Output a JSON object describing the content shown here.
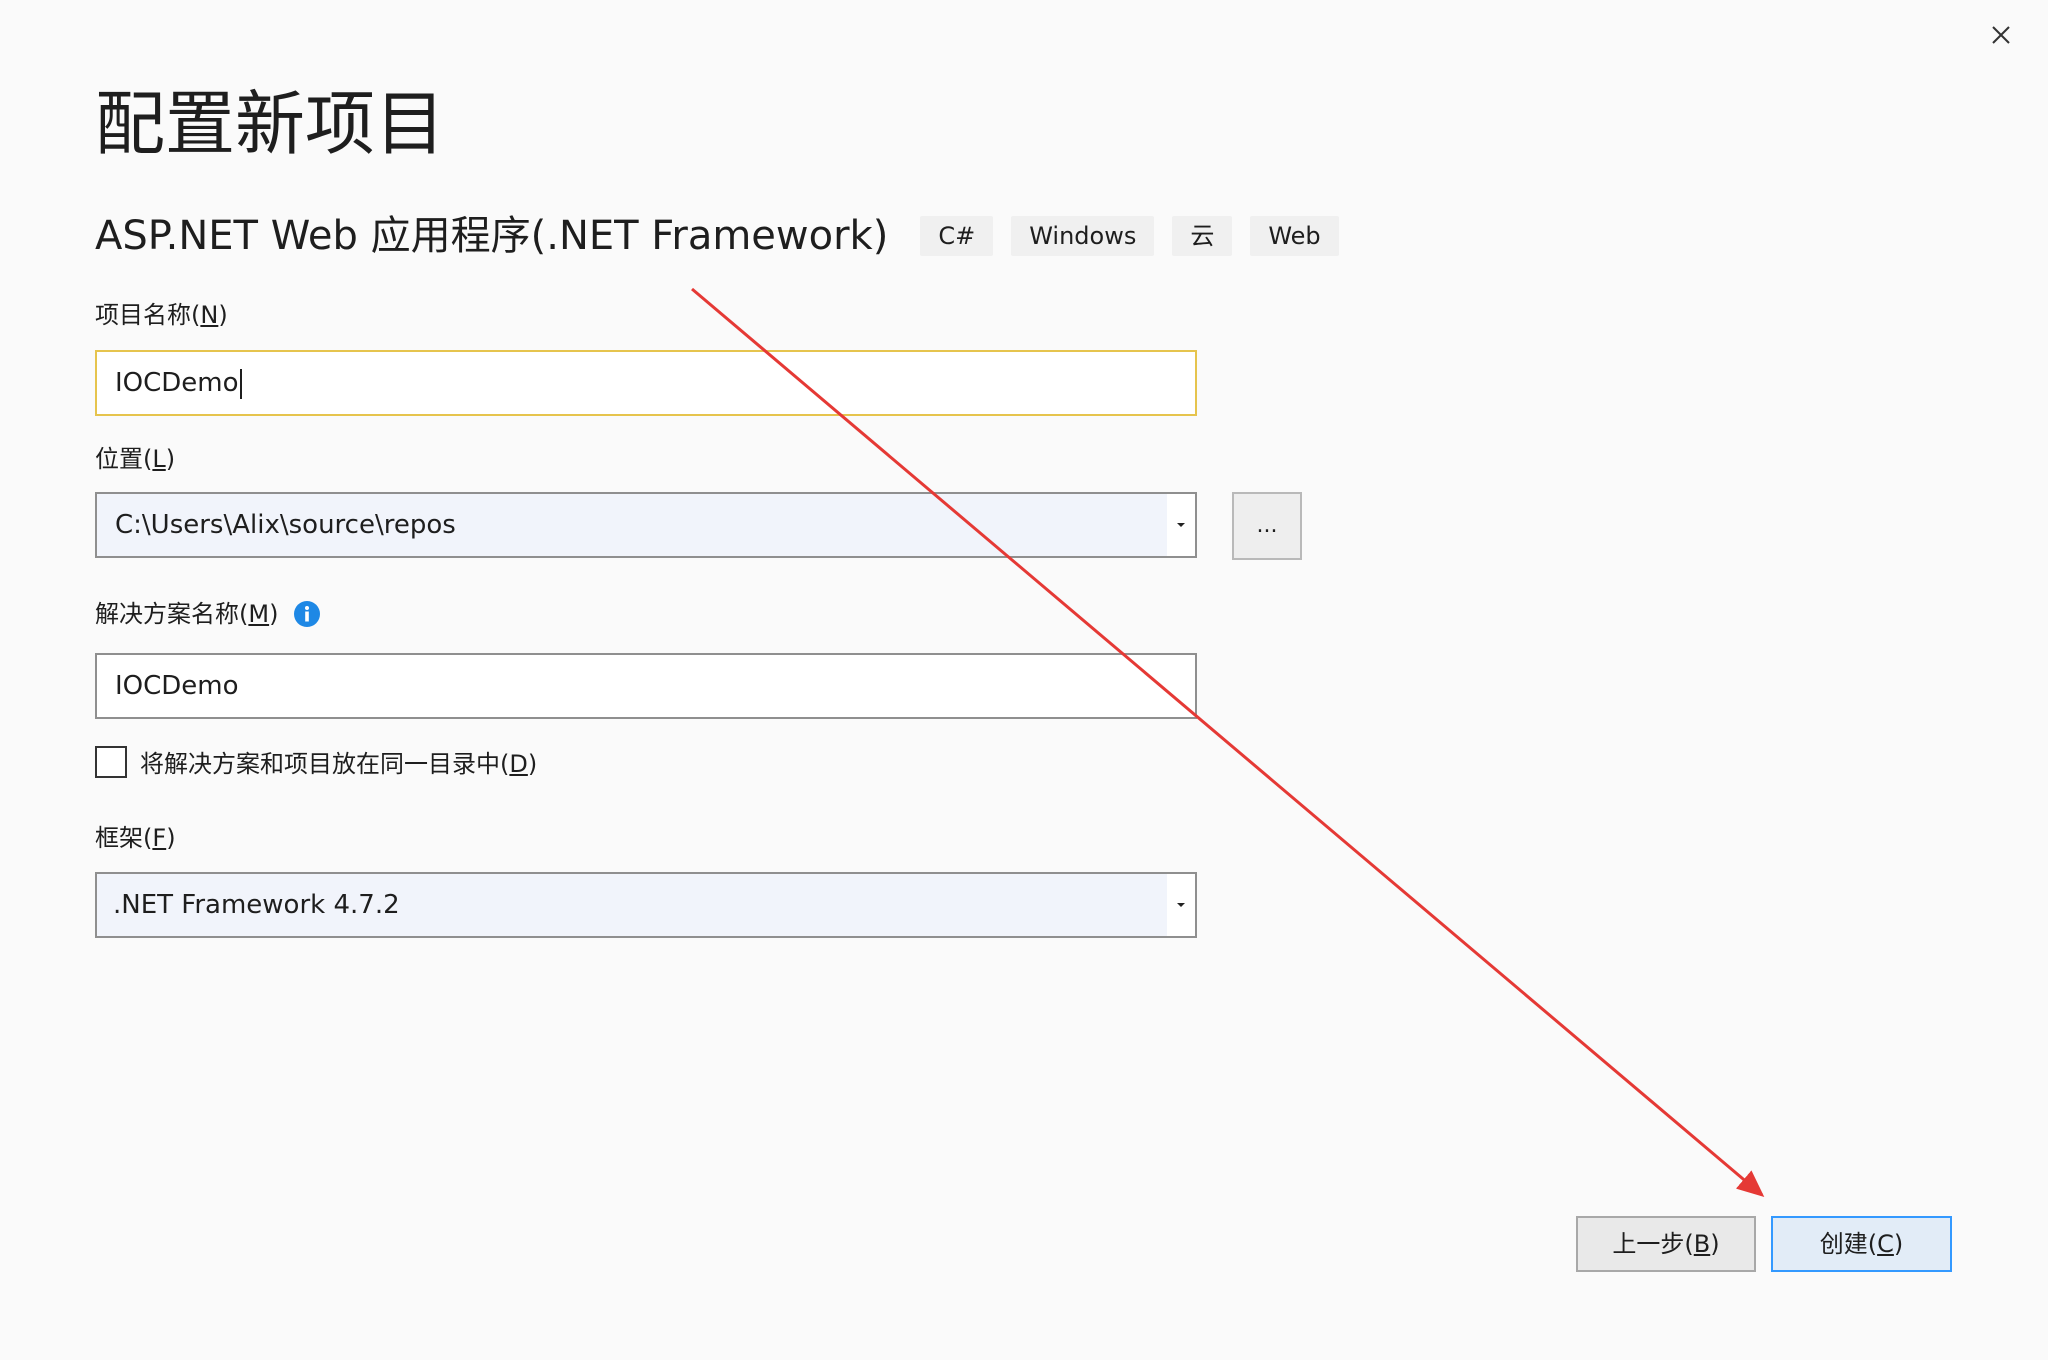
{
  "dialog": {
    "title": "配置新项目",
    "close_icon": "close-icon"
  },
  "template": {
    "name": "ASP.NET Web 应用程序(.NET Framework)",
    "tags": [
      "C#",
      "Windows",
      "云",
      "Web"
    ]
  },
  "project_name": {
    "label": "项目名称(",
    "accesskey": "N",
    "label_end": ")",
    "value": "IOCDemo"
  },
  "location": {
    "label": "位置(",
    "accesskey": "L",
    "label_end": ")",
    "value": "C:\\Users\\Alix\\source\\repos",
    "browse_label": "..."
  },
  "solution_name": {
    "label": "解决方案名称(",
    "accesskey": "M",
    "label_end": ")",
    "value": "IOCDemo",
    "info_icon": "info-icon"
  },
  "same_dir": {
    "label": "将解决方案和项目放在同一目录中(",
    "accesskey": "D",
    "label_end": ")",
    "checked": false
  },
  "framework": {
    "label": "框架(",
    "accesskey": "F",
    "label_end": ")",
    "value": ".NET Framework 4.7.2"
  },
  "buttons": {
    "back_label": "上一步(",
    "back_key": "B",
    "back_end": ")",
    "create_label": "创建(",
    "create_key": "C",
    "create_end": ")"
  },
  "colors": {
    "focus_border": "#e6c44d",
    "primary_border": "#3399ff",
    "annotation_arrow": "#e53935",
    "info_icon": "#1e88e5"
  }
}
